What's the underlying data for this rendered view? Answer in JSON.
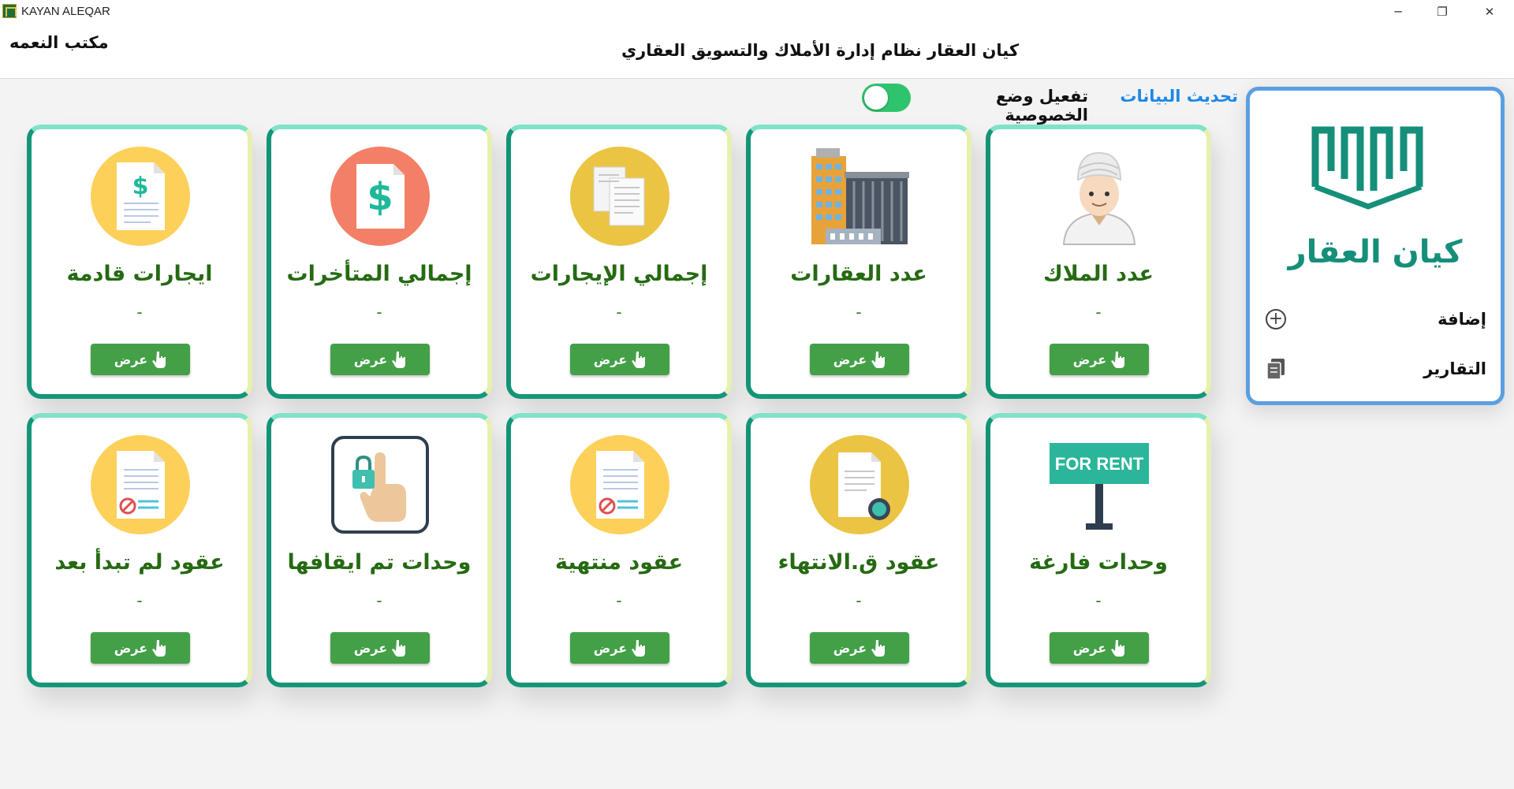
{
  "window": {
    "title": "KAYAN ALEQAR",
    "minimize": "─",
    "maximize": "❐",
    "close": "✕"
  },
  "header": {
    "office_name": "مكتب النعمه",
    "system_title": "كيان العقار نظام إدارة الأملاك والتسويق العقاري"
  },
  "toolbar": {
    "refresh_label": "تحديث البيانات",
    "privacy_label": "تفعيل وضع الخصوصية",
    "privacy_enabled": true,
    "toggle_color": "#2ec46d"
  },
  "side_panel": {
    "logo_text": "كيان العقار",
    "brand_color": "#158f7a",
    "menu": [
      {
        "label": "إضافة",
        "icon": "plus-circle-icon"
      },
      {
        "label": "التقارير",
        "icon": "documents-icon"
      }
    ]
  },
  "cards": [
    {
      "title": "عدد الملاك",
      "value": "-",
      "button": "عرض",
      "icon": "owner-person-icon"
    },
    {
      "title": "عدد العقارات",
      "value": "-",
      "button": "عرض",
      "icon": "buildings-icon"
    },
    {
      "title": "إجمالي الإيجارات",
      "value": "-",
      "button": "عرض",
      "icon": "documents-icon"
    },
    {
      "title": "إجمالي المتأخرات",
      "value": "-",
      "button": "عرض",
      "icon": "dollar-document-icon"
    },
    {
      "title": "ايجارات قادمة",
      "value": "-",
      "button": "عرض",
      "icon": "dollar-document-icon"
    },
    {
      "title": "وحدات فارغة",
      "value": "-",
      "button": "عرض",
      "icon": "for-rent-sign-icon",
      "sign_text": "FOR RENT"
    },
    {
      "title": "عقود ق.الانتهاء",
      "value": "-",
      "button": "عرض",
      "icon": "contract-clock-icon"
    },
    {
      "title": "عقود منتهية",
      "value": "-",
      "button": "عرض",
      "icon": "cancelled-document-icon"
    },
    {
      "title": "وحدات تم ايقافها",
      "value": "-",
      "button": "عرض",
      "icon": "locked-hand-icon"
    },
    {
      "title": "عقود لم تبدأ بعد",
      "value": "-",
      "button": "عرض",
      "icon": "cancelled-document-icon"
    }
  ],
  "colors": {
    "button_green": "#43a047",
    "title_green": "#256a12",
    "card_border": "#14967a",
    "link_blue": "#1e88e5"
  }
}
